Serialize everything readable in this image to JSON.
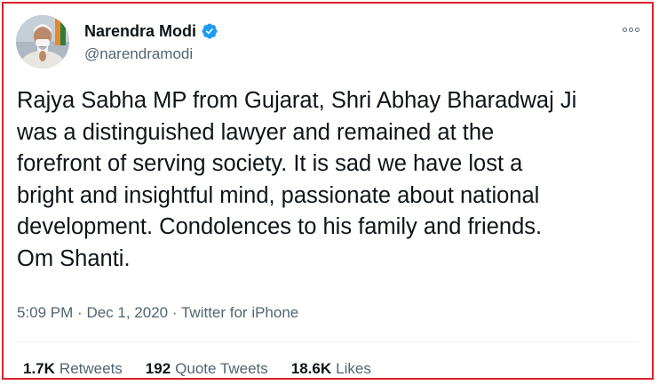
{
  "user": {
    "display_name": "Narendra Modi",
    "handle": "@narendramodi",
    "verified": true,
    "verified_color": "#1d9bf0"
  },
  "tweet": {
    "text": "Rajya Sabha MP from Gujarat, Shri Abhay Bharadwaj Ji\nwas a distinguished lawyer and remained at the\nforefront of serving society. It is sad we have lost a\nbright and insightful mind, passionate about national\ndevelopment. Condolences to his family and friends.\nOm Shanti.",
    "time": "5:09 PM",
    "separator": "·",
    "date": "Dec 1, 2020",
    "source": "Twitter for iPhone"
  },
  "stats": {
    "retweets_count": "1.7K",
    "retweets_label": "Retweets",
    "quotes_count": "192",
    "quotes_label": "Quote Tweets",
    "likes_count": "18.6K",
    "likes_label": "Likes"
  },
  "icons": {
    "more": "more-options-icon",
    "verified": "verified-badge-icon"
  },
  "colors": {
    "border": "#d9232b",
    "text": "#0f1419",
    "secondary": "#536471"
  }
}
